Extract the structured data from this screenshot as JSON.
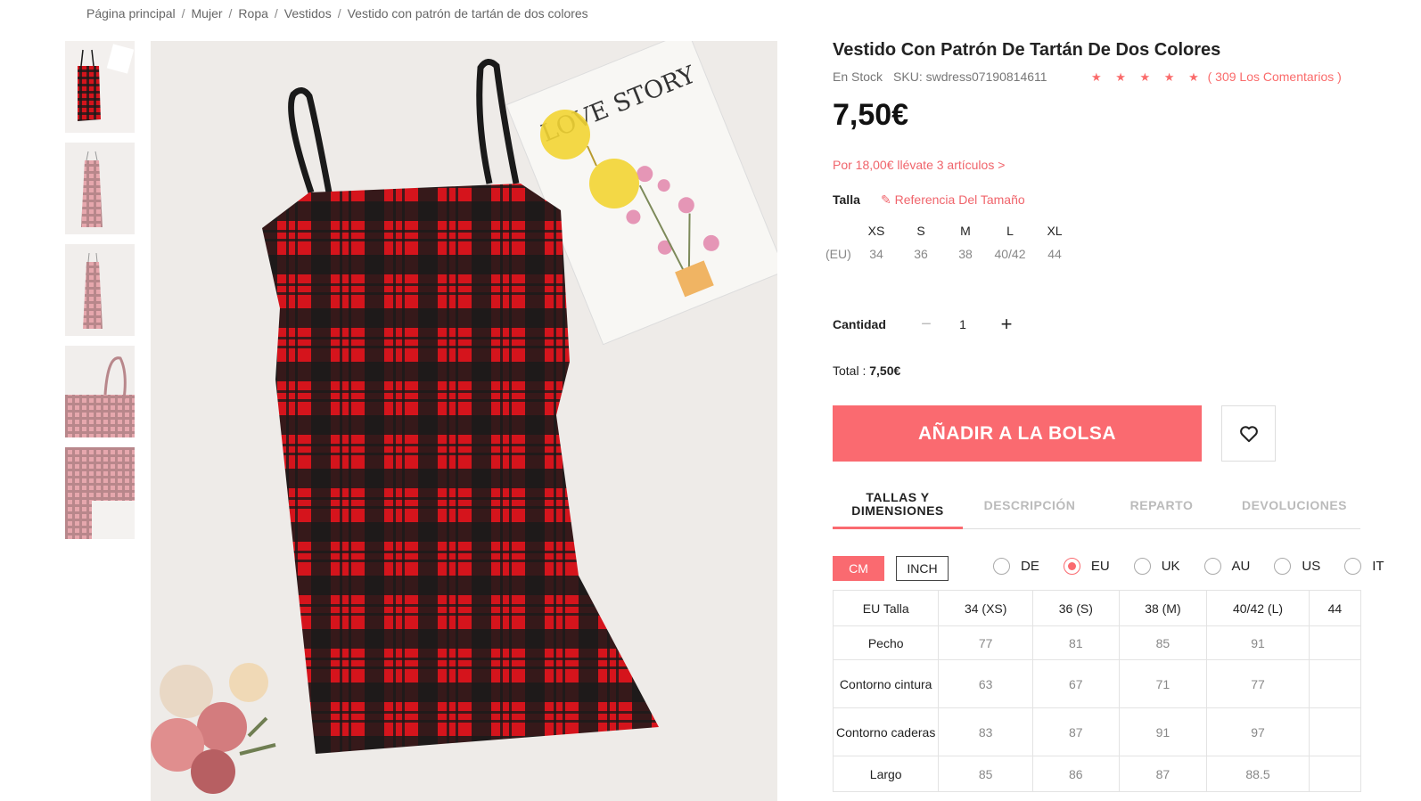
{
  "breadcrumb": [
    "Página principal",
    "Mujer",
    "Ropa",
    "Vestidos",
    "Vestido con patrón de tartán de dos colores"
  ],
  "product": {
    "title": "Vestido Con Patrón De Tartán De Dos Colores",
    "stock": "En Stock",
    "sku": "SKU: swdress07190814611",
    "stars": "★ ★ ★ ★ ★",
    "rating_count": 4.5,
    "reviews": "( 309 Los Comentarios )",
    "price": "7,50€",
    "promo": "Por 18,00€ llévate 3 artículos  >",
    "image_text": "LOVE STORY"
  },
  "size": {
    "label": "Talla",
    "reference": "Referencia Del Tamaño",
    "region_label": "(EU)",
    "options": [
      {
        "name": "XS",
        "eu": "34"
      },
      {
        "name": "S",
        "eu": "36"
      },
      {
        "name": "M",
        "eu": "38"
      },
      {
        "name": "L",
        "eu": "40/42"
      },
      {
        "name": "XL",
        "eu": "44"
      }
    ]
  },
  "quantity": {
    "label": "Cantidad",
    "minus": "−",
    "value": "1",
    "plus": "+"
  },
  "total": {
    "label": "Total : ",
    "value": "7,50€"
  },
  "buttons": {
    "add_to_bag": "AÑADIR A LA BOLSA"
  },
  "tabs": [
    {
      "label": "TALLAS Y DIMENSIONES",
      "active": true
    },
    {
      "label": "DESCRIPCIÓN",
      "active": false
    },
    {
      "label": "REPARTO",
      "active": false
    },
    {
      "label": "DEVOLUCIONES",
      "active": false
    }
  ],
  "units": {
    "cm": "CM",
    "inch": "INCH"
  },
  "regions": [
    {
      "label": "DE",
      "selected": false
    },
    {
      "label": "EU",
      "selected": true
    },
    {
      "label": "UK",
      "selected": false
    },
    {
      "label": "AU",
      "selected": false
    },
    {
      "label": "US",
      "selected": false
    },
    {
      "label": "IT",
      "selected": false
    }
  ],
  "size_table": {
    "header": [
      "EU Talla",
      "34 (XS)",
      "36 (S)",
      "38 (M)",
      "40/42 (L)",
      "44"
    ],
    "rows": [
      {
        "label": "Pecho",
        "values": [
          "77",
          "81",
          "85",
          "91",
          ""
        ]
      },
      {
        "label": "Contorno cintura",
        "values": [
          "63",
          "67",
          "71",
          "77",
          ""
        ]
      },
      {
        "label": "Contorno caderas",
        "values": [
          "83",
          "87",
          "91",
          "97",
          ""
        ]
      },
      {
        "label": "Largo",
        "values": [
          "85",
          "86",
          "87",
          "88.5",
          ""
        ]
      }
    ]
  },
  "colors": {
    "accent": "#fa6a70",
    "tartan_red": "#d5141c",
    "tartan_black": "#1a1a1a"
  }
}
